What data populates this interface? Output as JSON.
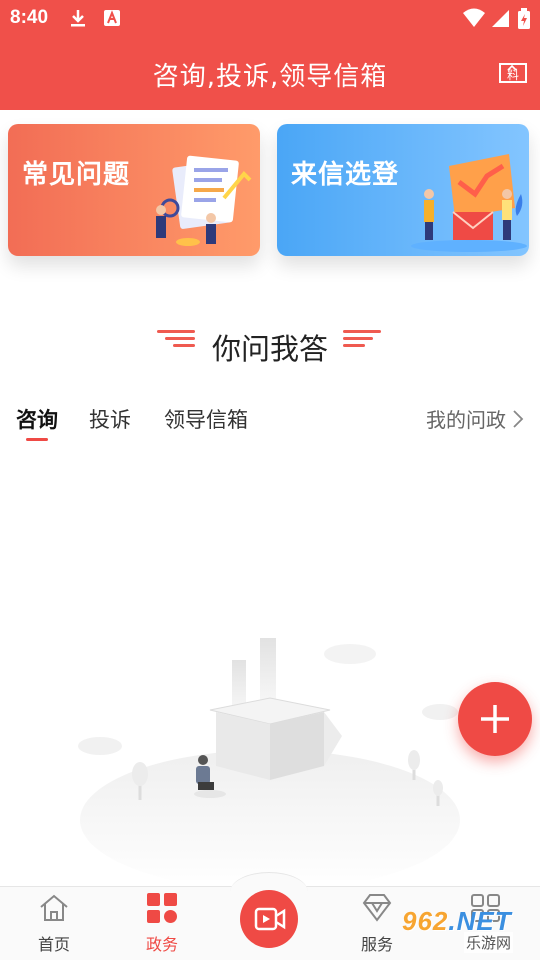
{
  "status_bar": {
    "time": "8:40"
  },
  "header": {
    "title": "咨询,投诉,领导信箱",
    "icon": "news-document-icon"
  },
  "cards": {
    "faq_title": "常见问题",
    "letters_title": "来信选登"
  },
  "section": {
    "title": "你问我答"
  },
  "tabs": [
    {
      "label": "咨询",
      "active": true
    },
    {
      "label": "投诉",
      "active": false
    },
    {
      "label": "领导信箱",
      "active": false
    }
  ],
  "my_politics": "我的问政",
  "bottom_nav": [
    {
      "label": "首页",
      "icon": "home-icon",
      "active": false
    },
    {
      "label": "政务",
      "icon": "grid-icon",
      "active": true
    },
    {
      "label": "",
      "icon": "video-camera-icon",
      "active": false
    },
    {
      "label": "服务",
      "icon": "diamond-icon",
      "active": false
    },
    {
      "label": "",
      "icon": "apps-icon",
      "active": false
    }
  ],
  "watermark": {
    "number": "962",
    "tld": ".NET",
    "sub": "乐游网"
  },
  "colors": {
    "primary": "#f0504a",
    "faq_card": "#f26d55",
    "letters_card": "#4aa6f6"
  }
}
